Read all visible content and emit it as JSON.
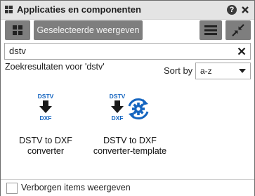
{
  "window": {
    "title": "Applicaties en componenten",
    "help_glyph": "?"
  },
  "toolbar": {
    "selected_label": "Geselecteerde weergeven"
  },
  "search": {
    "value": "dstv",
    "results_label": "Zoekresultaten voor 'dstv'"
  },
  "sort": {
    "label": "Sort by",
    "value": "a-z"
  },
  "items": [
    {
      "icon_top": "DSTV",
      "icon_bottom": "DXF",
      "label_line1": "DSTV to DXF",
      "label_line2": "converter"
    },
    {
      "icon_top": "DSTV",
      "icon_bottom": "DXF",
      "label_line1": "DSTV to DXF",
      "label_line2": "converter-template"
    }
  ],
  "footer": {
    "show_hidden_label": "Verborgen items weergeven",
    "show_hidden_checked": false
  },
  "colors": {
    "accent_blue": "#1565c0",
    "button_gray": "#7e7e7e",
    "titlebar_bg": "#e4e4e4"
  },
  "icons": [
    "app-icon",
    "help-icon",
    "close-icon",
    "grid-icon",
    "menu-icon",
    "collapse-icon",
    "clear-icon",
    "caret-down-icon",
    "download-arrow-icon",
    "sync-gear-icon"
  ]
}
